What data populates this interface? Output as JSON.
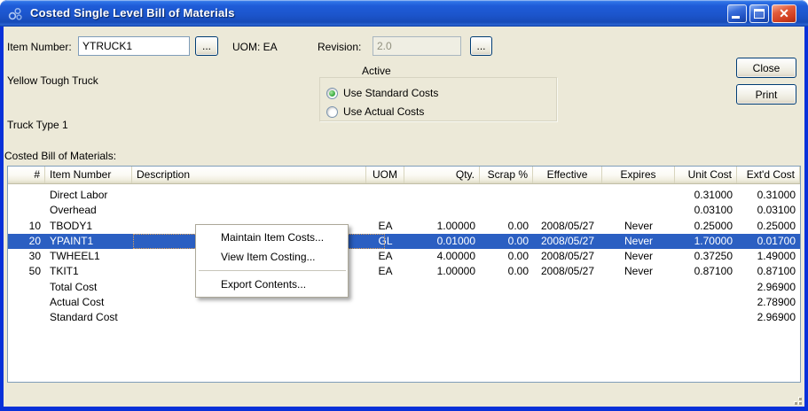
{
  "window": {
    "title": "Costed Single Level Bill of Materials"
  },
  "icons": {
    "app": "linked-circles-icon",
    "minimize": "minimize-icon",
    "maximize": "maximize-icon",
    "close": "close-icon"
  },
  "form": {
    "item_number": {
      "label": "Item Number:",
      "value": "YTRUCK1",
      "browse_label": "..."
    },
    "uom_text": "UOM: EA",
    "revision": {
      "label": "Revision:",
      "value": "2.0",
      "browse_label": "...",
      "disabled": true
    },
    "item_description": "Yellow Tough Truck",
    "item_type": "Truck Type 1",
    "active_group": {
      "label": "Active",
      "options": [
        {
          "label": "Use Standard Costs",
          "selected": true
        },
        {
          "label": "Use Actual Costs",
          "selected": false
        }
      ]
    },
    "buttons": {
      "close": "Close",
      "print": "Print"
    }
  },
  "bom": {
    "caption": "Costed Bill of Materials:",
    "columns": [
      "#",
      "Item Number",
      "Description",
      "UOM",
      "Qty.",
      "Scrap %",
      "Effective",
      "Expires",
      "Unit Cost",
      "Ext'd Cost"
    ],
    "rows": [
      [
        "",
        "Direct Labor",
        "",
        "",
        "",
        "",
        "",
        "",
        "0.31000",
        "0.31000"
      ],
      [
        "",
        "Overhead",
        "",
        "",
        "",
        "",
        "",
        "",
        "0.03100",
        "0.03100"
      ],
      [
        "10",
        "TBODY1",
        "",
        "EA",
        "1.00000",
        "0.00",
        "2008/05/27",
        "Never",
        "0.25000",
        "0.25000"
      ],
      [
        "20",
        "YPAINT1",
        "",
        "GL",
        "0.01000",
        "0.00",
        "2008/05/27",
        "Never",
        "1.70000",
        "0.01700"
      ],
      [
        "30",
        "TWHEEL1",
        "",
        "EA",
        "4.00000",
        "0.00",
        "2008/05/27",
        "Never",
        "0.37250",
        "1.49000"
      ],
      [
        "50",
        "TKIT1",
        "",
        "EA",
        "1.00000",
        "0.00",
        "2008/05/27",
        "Never",
        "0.87100",
        "0.87100"
      ],
      [
        "",
        "Total Cost",
        "",
        "",
        "",
        "",
        "",
        "",
        "",
        "2.96900"
      ],
      [
        "",
        "Actual Cost",
        "",
        "",
        "",
        "",
        "",
        "",
        "",
        "2.78900"
      ],
      [
        "",
        "Standard Cost",
        "",
        "",
        "",
        "",
        "",
        "",
        "",
        "2.96900"
      ]
    ],
    "selected_row_index": 3
  },
  "context_menu": {
    "items": [
      "Maintain Item Costs...",
      "View Item Costing...",
      "Export Contents..."
    ],
    "separator_after_index": 1
  },
  "colors": {
    "titlebar_blue": "#1C55CC",
    "window_border_blue": "#0831D9",
    "client_bg": "#ECE9D8",
    "selection_bg": "#2B5FC2",
    "selection_text": "#FFFFFF",
    "table_border": "#7F9DB9",
    "focus_dotted_orange": "#E5A353",
    "close_button_red": "#CE3C1F",
    "radio_green": "#47B34B"
  }
}
